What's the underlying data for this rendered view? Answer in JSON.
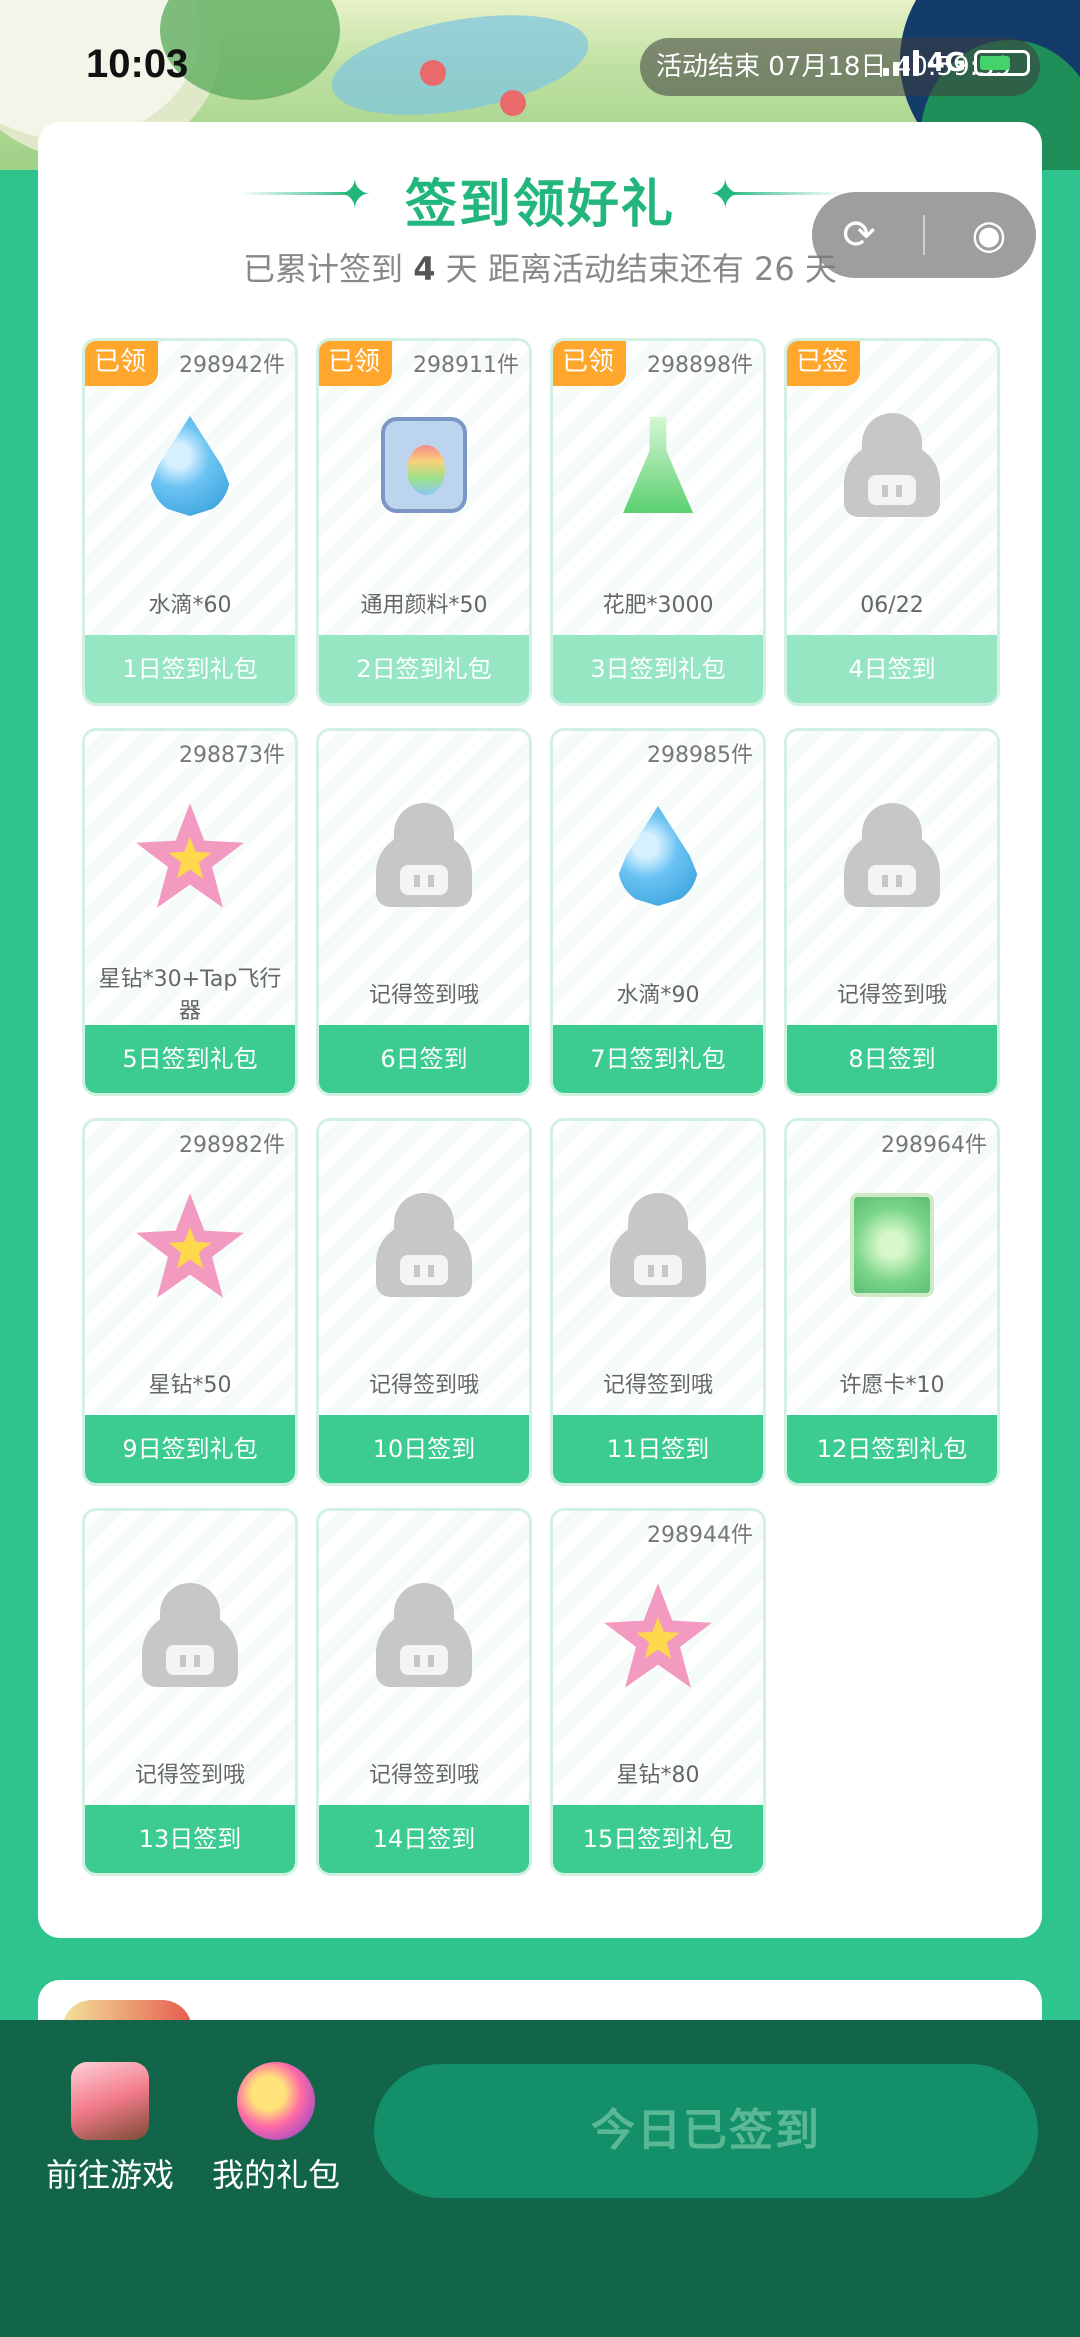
{
  "status": {
    "time": "10:03",
    "activity_text": "活动结束 07月18日 40:59:59",
    "network": "4G"
  },
  "header": {
    "title": "签到领好礼",
    "subtitle_prefix": "已累计签到",
    "signed_days": "4",
    "subtitle_mid": "天  距离活动结束还有",
    "remaining_days": "26",
    "subtitle_suffix": "天"
  },
  "capsule": {
    "share_icon": "share-icon",
    "close_icon": "target-icon"
  },
  "rewards": [
    {
      "badge": "已领",
      "count": "298942件",
      "icon": "water-drop",
      "label": "水滴*60",
      "footer": "1日签到礼包",
      "state": "claimed"
    },
    {
      "badge": "已领",
      "count": "298911件",
      "icon": "paint-bag",
      "label": "通用颜料*50",
      "footer": "2日签到礼包",
      "state": "claimed"
    },
    {
      "badge": "已领",
      "count": "298898件",
      "icon": "fertilizer-flask",
      "label": "花肥*3000",
      "footer": "3日签到礼包",
      "state": "claimed"
    },
    {
      "badge": "已签",
      "count": "",
      "icon": "placeholder-ghost",
      "label": "06/22",
      "footer": "4日签到",
      "state": "claimed"
    },
    {
      "badge": "",
      "count": "298873件",
      "icon": "star-diamond",
      "label": "星钻*30+Tap飞行器",
      "footer": "5日签到礼包",
      "state": "open"
    },
    {
      "badge": "",
      "count": "",
      "icon": "placeholder-ghost",
      "label": "记得签到哦",
      "footer": "6日签到",
      "state": "open"
    },
    {
      "badge": "",
      "count": "298985件",
      "icon": "water-drop",
      "label": "水滴*90",
      "footer": "7日签到礼包",
      "state": "open"
    },
    {
      "badge": "",
      "count": "",
      "icon": "placeholder-ghost",
      "label": "记得签到哦",
      "footer": "8日签到",
      "state": "open"
    },
    {
      "badge": "",
      "count": "298982件",
      "icon": "star-diamond",
      "label": "星钻*50",
      "footer": "9日签到礼包",
      "state": "open"
    },
    {
      "badge": "",
      "count": "",
      "icon": "placeholder-ghost",
      "label": "记得签到哦",
      "footer": "10日签到",
      "state": "open"
    },
    {
      "badge": "",
      "count": "",
      "icon": "placeholder-ghost",
      "label": "记得签到哦",
      "footer": "11日签到",
      "state": "open"
    },
    {
      "badge": "",
      "count": "298964件",
      "icon": "wish-card",
      "label": "许愿卡*10",
      "footer": "12日签到礼包",
      "state": "open"
    },
    {
      "badge": "",
      "count": "",
      "icon": "placeholder-ghost",
      "label": "记得签到哦",
      "footer": "13日签到",
      "state": "open"
    },
    {
      "badge": "",
      "count": "",
      "icon": "placeholder-ghost",
      "label": "记得签到哦",
      "footer": "14日签到",
      "state": "open"
    },
    {
      "badge": "",
      "count": "298944件",
      "icon": "star-diamond",
      "label": "星钻*80",
      "footer": "15日签到礼包",
      "state": "open"
    }
  ],
  "bottom_bar": {
    "game_label": "前往游戏",
    "gift_label": "我的礼包",
    "cta_label": "今日已签到"
  },
  "colors": {
    "accent": "#22b67c",
    "background": "#2fc48d",
    "claimed_footer": "#96e5c3",
    "open_footer": "#3ccb91",
    "badge": "#ffa62c",
    "bottom_bar": "#13654a"
  }
}
